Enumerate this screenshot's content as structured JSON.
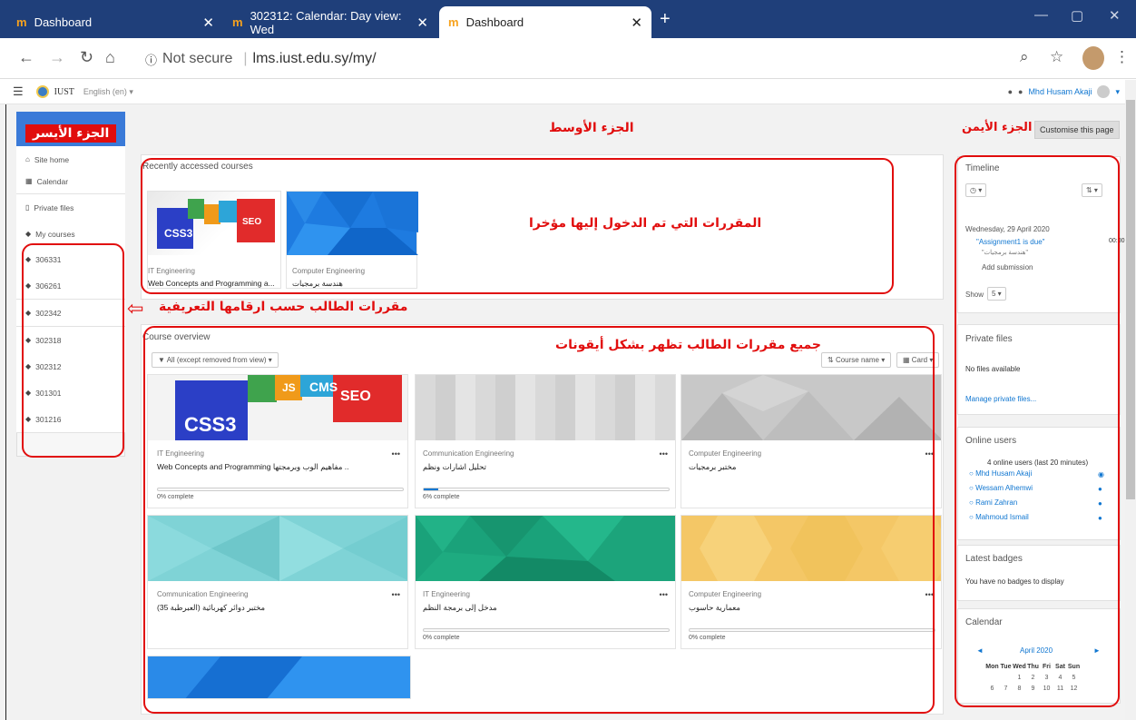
{
  "browser": {
    "tabs": [
      {
        "title": "Dashboard",
        "favicon": "moodle-icon"
      },
      {
        "title": "302312: Calendar: Day view: Wed",
        "favicon": "moodle-icon"
      },
      {
        "title": "Dashboard",
        "favicon": "moodle-icon",
        "active": true
      }
    ],
    "url_security": "Not secure",
    "url": "lms.iust.edu.sy/my/"
  },
  "navbar": {
    "site": "IUST",
    "language": "English (en) ▾",
    "user": "Mhd Husam Akaji"
  },
  "left_drawer": {
    "items": [
      {
        "label": "Site home",
        "icon": "home-icon"
      },
      {
        "label": "Calendar",
        "icon": "calendar-icon"
      },
      {
        "label": "Private files",
        "icon": "file-icon"
      },
      {
        "label": "My courses",
        "icon": "graduation-cap-icon"
      }
    ],
    "courses": [
      "306331",
      "306261",
      "302342",
      "302318",
      "302312",
      "301301",
      "301216"
    ]
  },
  "recent": {
    "title": "Recently accessed courses",
    "cards": [
      {
        "category": "IT Engineering",
        "name": "Web Concepts and Programming a..."
      },
      {
        "category": "Computer Engineering",
        "name": "هندسة برمجيات"
      }
    ]
  },
  "overview": {
    "title": "Course overview",
    "filter": "All (except removed from view)",
    "sort": "Course name",
    "view": "Card",
    "cards": [
      {
        "category": "IT Engineering",
        "name": "Web Concepts and Programming مفاهيم الوب وبرمجتها ..",
        "progress": "0% complete",
        "pct": 0
      },
      {
        "category": "Communication Engineering",
        "name": "تحليل اشارات ونظم",
        "progress": "6% complete",
        "pct": 6
      },
      {
        "category": "Computer Engineering",
        "name": "مختبر برمجيات",
        "progress": "",
        "pct": null
      },
      {
        "category": "Communication Engineering",
        "name": "مختبر دوائر كهربائية (العبرطبة 35)",
        "progress": "",
        "pct": null
      },
      {
        "category": "IT Engineering",
        "name": "مدخل إلى برمجة النظم",
        "progress": "0% complete",
        "pct": 0
      },
      {
        "category": "Computer Engineering",
        "name": "معمارية حاسوب",
        "progress": "0% complete",
        "pct": 0
      }
    ]
  },
  "timeline": {
    "title": "Timeline",
    "date": "Wednesday, 29 April 2020",
    "event": "\"Assignment1 is due\"",
    "event_course": "\"هندسة برمجيات\"",
    "time": "00:00",
    "action": "Add submission",
    "show_label": "Show",
    "show_value": "5"
  },
  "private_files": {
    "title": "Private files",
    "empty": "No files available",
    "manage": "Manage private files..."
  },
  "online_users": {
    "title": "Online users",
    "summary": "4 online users (last 20 minutes)",
    "users": [
      "Mhd Husam Akaji",
      "Wessam Alhemwi",
      "Rami Zahran",
      "Mahmoud Ismail"
    ]
  },
  "badges": {
    "title": "Latest badges",
    "empty": "You have no badges to display"
  },
  "calendar": {
    "title": "Calendar",
    "month": "April 2020",
    "days": [
      "Mon",
      "Tue",
      "Wed",
      "Thu",
      "Fri",
      "Sat",
      "Sun"
    ],
    "week1": [
      "",
      "",
      "1",
      "2",
      "3",
      "4",
      "5"
    ],
    "week2": [
      "6",
      "7",
      "8",
      "9",
      "10",
      "11",
      "12"
    ]
  },
  "customise_button": "Customise this page",
  "annotations": {
    "left": "الجزء الأيسر",
    "middle": "الجزء الأوسط",
    "right": "الجزء الأيمن",
    "recent": "المقررات التي تم الدخول إليها مؤخرا",
    "courses_ids": "مقررات الطالب حسب ارقامها التعريفية",
    "all_courses": "جميع مقررات الطالب تظهر بشكل أيقونات"
  },
  "colors": {
    "annotation": "#e10d0d",
    "drawer_header": "#3a7ad8",
    "browser_tabbar": "#1f3f7a"
  }
}
